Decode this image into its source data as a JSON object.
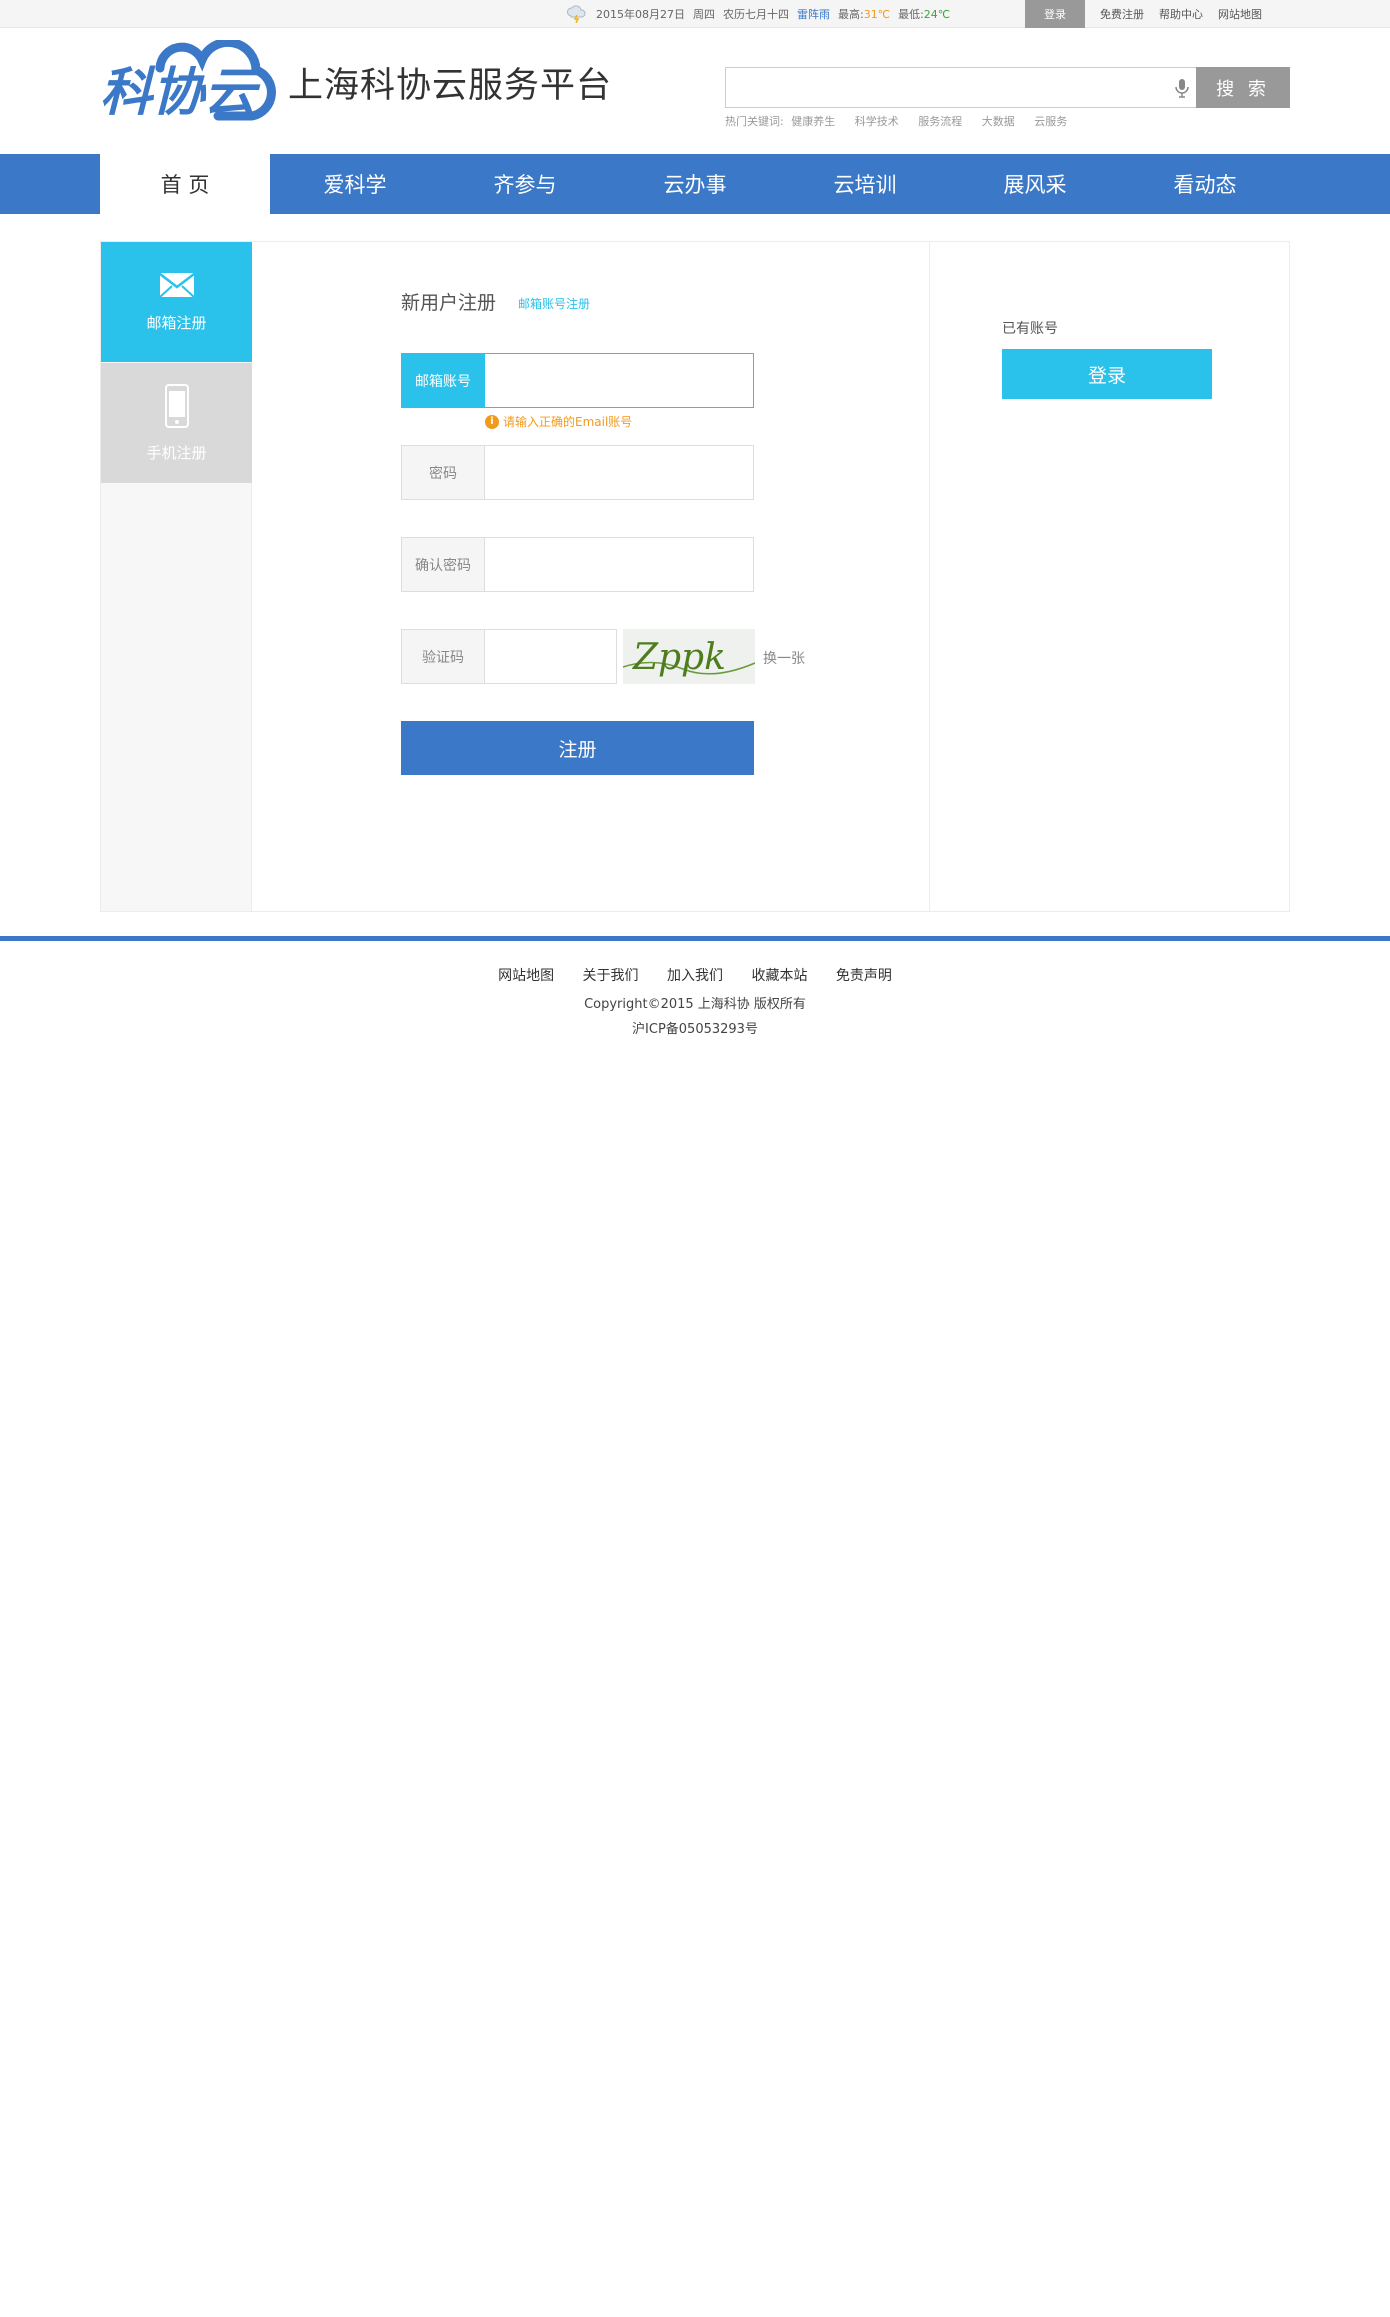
{
  "topbar": {
    "date": "2015年08月27日",
    "weekday": "周四",
    "lunar": "农历七月十四",
    "weather": "雷阵雨",
    "high_label": "最高:",
    "high": "31℃",
    "low_label": "最低:",
    "low": "24℃",
    "login": "登录",
    "register": "免费注册",
    "help": "帮助中心",
    "sitemap": "网站地图"
  },
  "header": {
    "logo_text": "科协云",
    "site_title": "上海科协云服务平台",
    "search_placeholder": "",
    "search_button": "搜 索",
    "hot_label": "热门关键词:",
    "hot_keywords": [
      "健康养生",
      "科学技术",
      "服务流程",
      "大数据",
      "云服务"
    ]
  },
  "nav": [
    "首 页",
    "爱科学",
    "齐参与",
    "云办事",
    "云培训",
    "展风采",
    "看动态"
  ],
  "sidebar": {
    "email_tab": "邮箱注册",
    "phone_tab": "手机注册"
  },
  "form": {
    "title": "新用户注册",
    "subtitle": "邮箱账号注册",
    "email_label": "邮箱账号",
    "email_error": "请输入正确的Email账号",
    "password_label": "密码",
    "confirm_label": "确认密码",
    "captcha_label": "验证码",
    "captcha_text": "Zppk",
    "swap": "换一张",
    "submit": "注册"
  },
  "account": {
    "have_account": "已有账号",
    "login": "登录"
  },
  "footer": {
    "links": [
      "网站地图",
      "关于我们",
      "加入我们",
      "收藏本站",
      "免责声明"
    ],
    "copyright": "Copyright©2015 上海科协 版权所有",
    "icp": "沪ICP备05053293号"
  },
  "colors": {
    "primary_blue": "#3b78c7",
    "accent_cyan": "#2ac1ea",
    "warning_orange": "#f29a1c"
  }
}
